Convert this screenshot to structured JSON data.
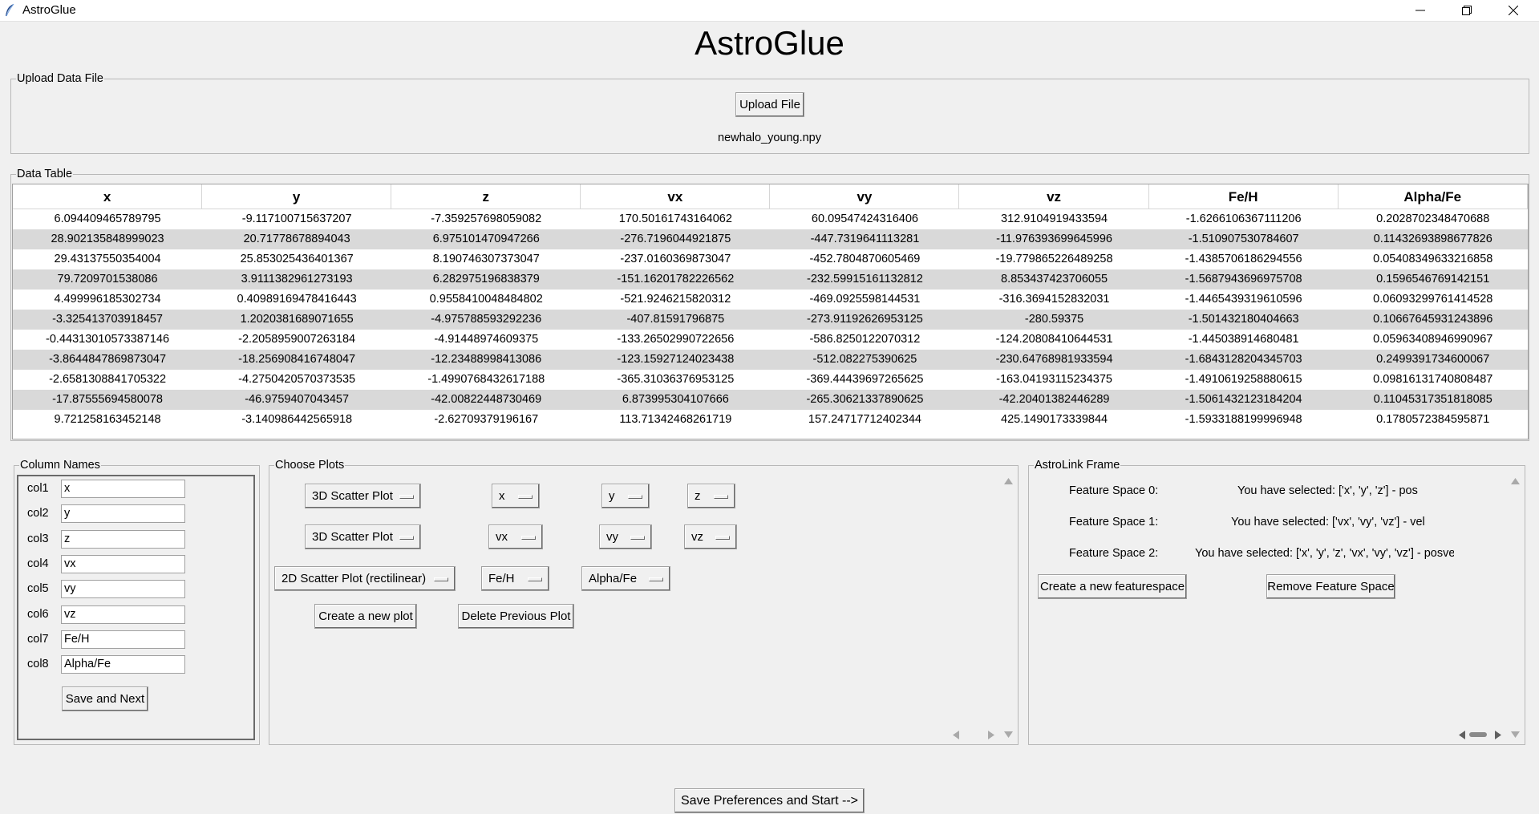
{
  "window": {
    "title": "AstroGlue"
  },
  "heading": "AstroGlue",
  "upload": {
    "group_label": "Upload Data File",
    "button_label": "Upload File",
    "filename": "newhalo_young.npy"
  },
  "table": {
    "group_label": "Data Table",
    "columns": [
      "x",
      "y",
      "z",
      "vx",
      "vy",
      "vz",
      "Fe/H",
      "Alpha/Fe"
    ],
    "rows": [
      [
        "6.094409465789795",
        "-9.117100715637207",
        "-7.359257698059082",
        "170.50161743164062",
        "60.09547424316406",
        "312.9104919433594",
        "-1.6266106367111206",
        "0.2028702348470688"
      ],
      [
        "28.902135848999023",
        "20.71778678894043",
        "6.975101470947266",
        "-276.7196044921875",
        "-447.7319641113281",
        "-11.976393699645996",
        "-1.510907530784607",
        "0.11432693898677826"
      ],
      [
        "29.43137550354004",
        "25.853025436401367",
        "8.190746307373047",
        "-237.0160369873047",
        "-452.7804870605469",
        "-19.779865226489258",
        "-1.4385706186294556",
        "0.05408349633216858"
      ],
      [
        "79.7209701538086",
        "3.9111382961273193",
        "6.282975196838379",
        "-151.16201782226562",
        "-232.59915161132812",
        "8.853437423706055",
        "-1.5687943696975708",
        "0.1596546769142151"
      ],
      [
        "4.499996185302734",
        "0.40989169478416443",
        "0.9558410048484802",
        "-521.9246215820312",
        "-469.0925598144531",
        "-316.3694152832031",
        "-1.4465439319610596",
        "0.06093299761414528"
      ],
      [
        "-3.325413703918457",
        "1.2020381689071655",
        "-4.975788593292236",
        "-407.81591796875",
        "-273.91192626953125",
        "-280.59375",
        "-1.501432180404663",
        "0.10667645931243896"
      ],
      [
        "-0.44313010573387146",
        "-2.2058959007263184",
        "-4.91448974609375",
        "-133.26502990722656",
        "-586.8250122070312",
        "-124.20808410644531",
        "-1.445038914680481",
        "0.05963408946990967"
      ],
      [
        "-3.8644847869873047",
        "-18.256908416748047",
        "-12.23488998413086",
        "-123.15927124023438",
        "-512.082275390625",
        "-230.64768981933594",
        "-1.6843128204345703",
        "0.2499391734600067"
      ],
      [
        "-2.6581308841705322",
        "-4.2750420570373535",
        "-1.4990768432617188",
        "-365.31036376953125",
        "-369.44439697265625",
        "-163.04193115234375",
        "-1.4910619258880615",
        "0.09816131740808487"
      ],
      [
        "-17.87555694580078",
        "-46.9759407043457",
        "-42.00822448730469",
        "6.873995304107666",
        "-265.30621337890625",
        "-42.20401382446289",
        "-1.5061432123184204",
        "0.11045317351818085"
      ],
      [
        "9.721258163452148",
        "-3.140986442565918",
        "-2.62709379196167",
        "113.71342468261719",
        "157.24717712402344",
        "425.1490173339844",
        "-1.5933188199996948",
        "0.1780572384595871"
      ]
    ]
  },
  "column_names": {
    "group_label": "Column Names",
    "labels": [
      "col1",
      "col2",
      "col3",
      "col4",
      "col5",
      "col6",
      "col7",
      "col8"
    ],
    "values": [
      "x",
      "y",
      "z",
      "vx",
      "vy",
      "vz",
      "Fe/H",
      "Alpha/Fe"
    ],
    "save_next_label": "Save and Next"
  },
  "choose_plots": {
    "group_label": "Choose Plots",
    "rows": [
      {
        "type": "3D Scatter Plot",
        "axes": [
          "x",
          "y",
          "z"
        ]
      },
      {
        "type": "3D Scatter Plot",
        "axes": [
          "vx",
          "vy",
          "vz"
        ]
      },
      {
        "type": "2D Scatter Plot (rectilinear)",
        "axes": [
          "Fe/H",
          "Alpha/Fe"
        ]
      }
    ],
    "create_label": "Create a new plot",
    "delete_label": "Delete Previous Plot"
  },
  "astrolink": {
    "group_label": "AstroLink Frame",
    "feature_spaces": [
      {
        "label": "Feature Space 0:",
        "text": "You have selected: ['x', 'y', 'z'] - pos"
      },
      {
        "label": "Feature Space 1:",
        "text": "You have selected: ['vx', 'vy', 'vz'] - vel"
      },
      {
        "label": "Feature Space 2:",
        "text": "You have selected: ['x', 'y', 'z', 'vx', 'vy', 'vz'] - posvel"
      }
    ],
    "create_label": "Create a new featurespace",
    "remove_label": "Remove Feature Space"
  },
  "start_label": "Save Preferences and Start -->"
}
